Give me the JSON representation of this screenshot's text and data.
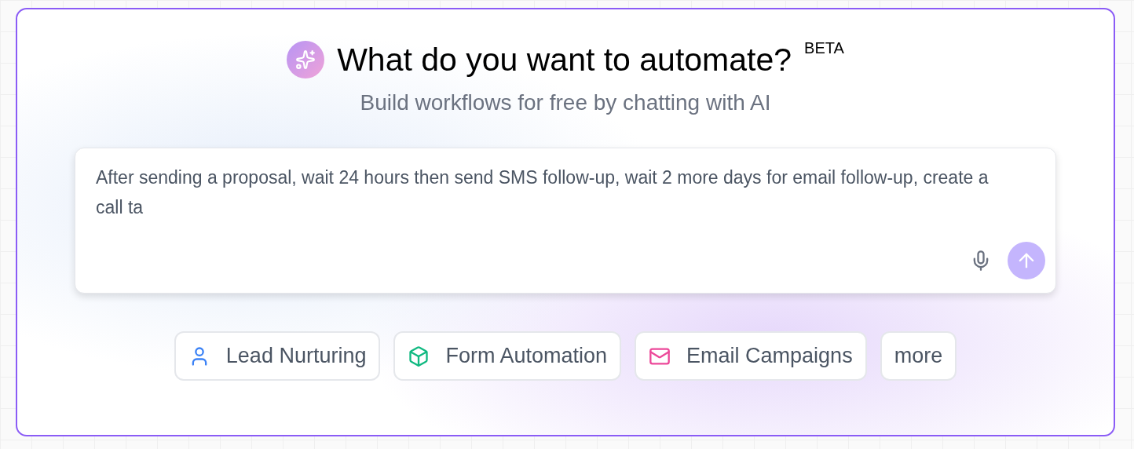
{
  "header": {
    "title": "What do you want to automate?",
    "badge": "BETA",
    "subtitle": "Build workflows for free by chatting with AI"
  },
  "prompt": {
    "value": "After sending a proposal, wait 24 hours then send SMS follow-up, wait 2 more days for email follow-up, create a call ta"
  },
  "suggestions": [
    {
      "label": "Lead Nurturing",
      "kind": "person"
    },
    {
      "label": "Form Automation",
      "kind": "cube"
    },
    {
      "label": "Email Campaigns",
      "kind": "mail"
    },
    {
      "label": "more",
      "kind": "plain"
    }
  ]
}
